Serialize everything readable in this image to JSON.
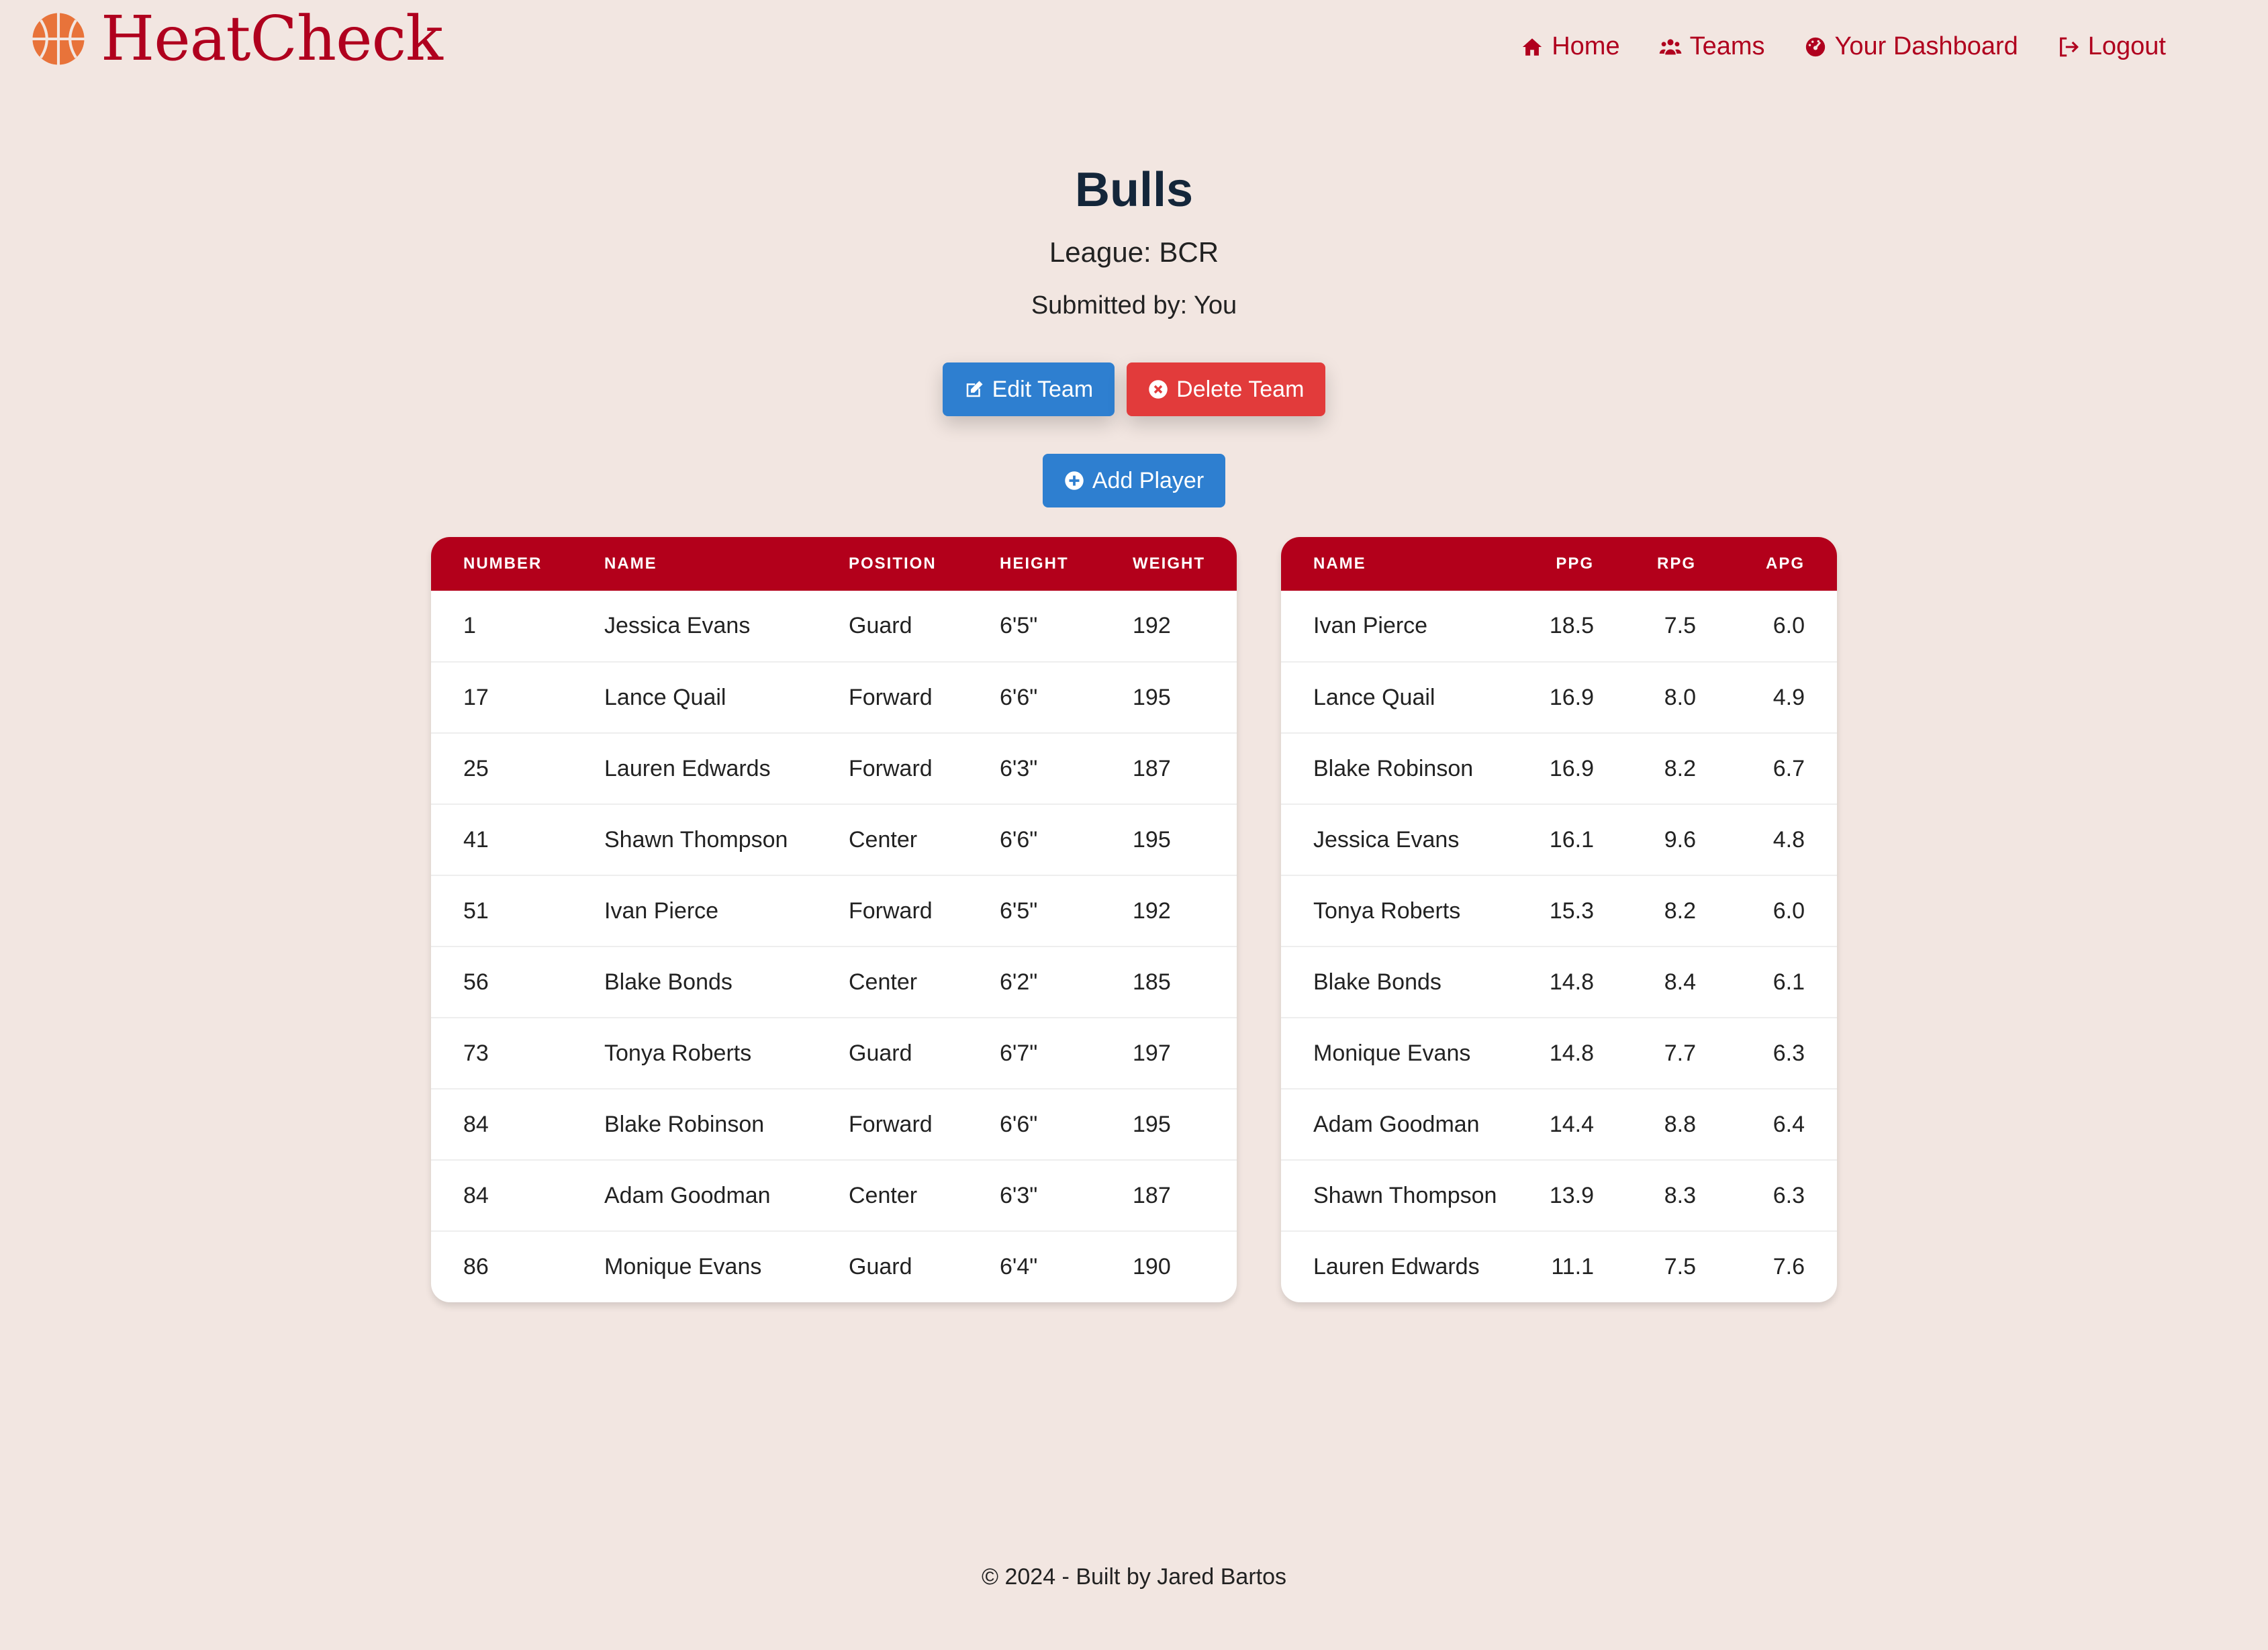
{
  "brand": {
    "name": "HeatCheck",
    "logo_icon": "basketball-icon"
  },
  "nav": {
    "home": "Home",
    "teams": "Teams",
    "dashboard": "Your Dashboard",
    "logout": "Logout"
  },
  "team": {
    "name": "Bulls",
    "league": "League: BCR",
    "submitted_by": "Submitted by: You"
  },
  "actions": {
    "edit": "Edit Team",
    "delete": "Delete Team",
    "add_player": "Add Player"
  },
  "roster": {
    "headers": [
      "NUMBER",
      "NAME",
      "POSITION",
      "HEIGHT",
      "WEIGHT"
    ],
    "rows": [
      [
        "1",
        "Jessica Evans",
        "Guard",
        "6'5\"",
        "192"
      ],
      [
        "17",
        "Lance Quail",
        "Forward",
        "6'6\"",
        "195"
      ],
      [
        "25",
        "Lauren Edwards",
        "Forward",
        "6'3\"",
        "187"
      ],
      [
        "41",
        "Shawn Thompson",
        "Center",
        "6'6\"",
        "195"
      ],
      [
        "51",
        "Ivan Pierce",
        "Forward",
        "6'5\"",
        "192"
      ],
      [
        "56",
        "Blake Bonds",
        "Center",
        "6'2\"",
        "185"
      ],
      [
        "73",
        "Tonya Roberts",
        "Guard",
        "6'7\"",
        "197"
      ],
      [
        "84",
        "Blake Robinson",
        "Forward",
        "6'6\"",
        "195"
      ],
      [
        "84",
        "Adam Goodman",
        "Center",
        "6'3\"",
        "187"
      ],
      [
        "86",
        "Monique Evans",
        "Guard",
        "6'4\"",
        "190"
      ]
    ]
  },
  "stats": {
    "headers": [
      "NAME",
      "PPG",
      "RPG",
      "APG"
    ],
    "rows": [
      [
        "Ivan Pierce",
        "18.5",
        "7.5",
        "6.0"
      ],
      [
        "Lance Quail",
        "16.9",
        "8.0",
        "4.9"
      ],
      [
        "Blake Robinson",
        "16.9",
        "8.2",
        "6.7"
      ],
      [
        "Jessica Evans",
        "16.1",
        "9.6",
        "4.8"
      ],
      [
        "Tonya Roberts",
        "15.3",
        "8.2",
        "6.0"
      ],
      [
        "Blake Bonds",
        "14.8",
        "8.4",
        "6.1"
      ],
      [
        "Monique Evans",
        "14.8",
        "7.7",
        "6.3"
      ],
      [
        "Adam Goodman",
        "14.4",
        "8.8",
        "6.4"
      ],
      [
        "Shawn Thompson",
        "13.9",
        "8.3",
        "6.3"
      ],
      [
        "Lauren Edwards",
        "11.1",
        "7.5",
        "7.6"
      ]
    ]
  },
  "footer": {
    "text": "© 2024 - Built by Jared Bartos"
  },
  "colors": {
    "page_bg": "#f2e6e1",
    "brand_red": "#b0001e",
    "table_header": "#b3001b",
    "button_blue": "#2e7fd0",
    "button_red": "#e23b3b",
    "logo_orange": "#e8733a"
  }
}
